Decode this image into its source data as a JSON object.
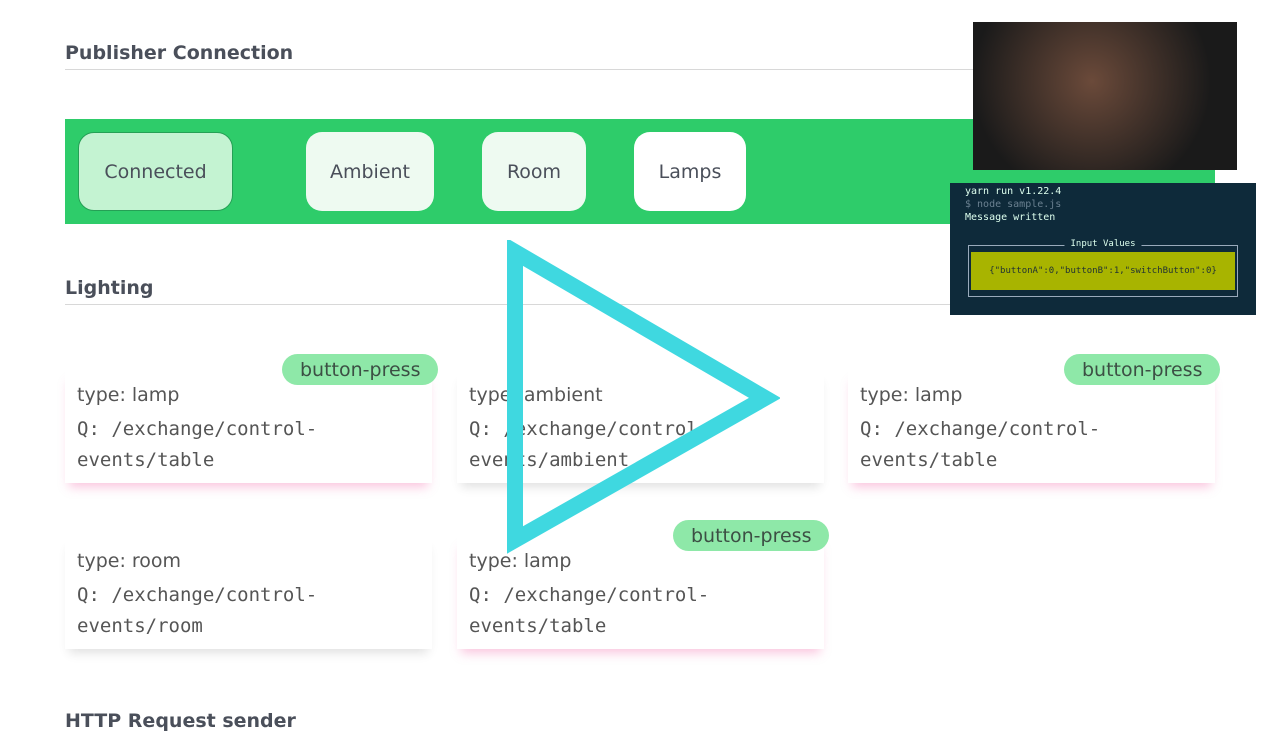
{
  "publisher": {
    "title": "Publisher Connection",
    "buttons": [
      "Connected",
      "Ambient",
      "Room",
      "Lamps"
    ]
  },
  "lighting": {
    "title": "Lighting",
    "cards": [
      {
        "type": "type: lamp",
        "q1": "Q: /exchange/control-",
        "q2": "events/table",
        "badge": "button-press"
      },
      {
        "type": "type: ambient",
        "q1": "Q: /exchange/control-",
        "q2": "events/ambient",
        "badge": null
      },
      {
        "type": "type: lamp",
        "q1": "Q: /exchange/control-",
        "q2": "events/table",
        "badge": "button-press"
      },
      {
        "type": "type: room",
        "q1": "Q: /exchange/control-",
        "q2": "events/room",
        "badge": null
      },
      {
        "type": "type: lamp",
        "q1": "Q: /exchange/control-",
        "q2": "events/table",
        "badge": "button-press"
      }
    ]
  },
  "next_section": {
    "title": "HTTP Request sender"
  },
  "terminal": {
    "lines": [
      "yarn run v1.22.4",
      "$ node sample.js",
      "Message written"
    ],
    "box_label": "Input Values",
    "box_value": "{\"buttonA\":0,\"buttonB\":1,\"switchButton\":0}"
  },
  "colors": {
    "accent": "#2ecc6a",
    "play": "#3fd8e0"
  }
}
